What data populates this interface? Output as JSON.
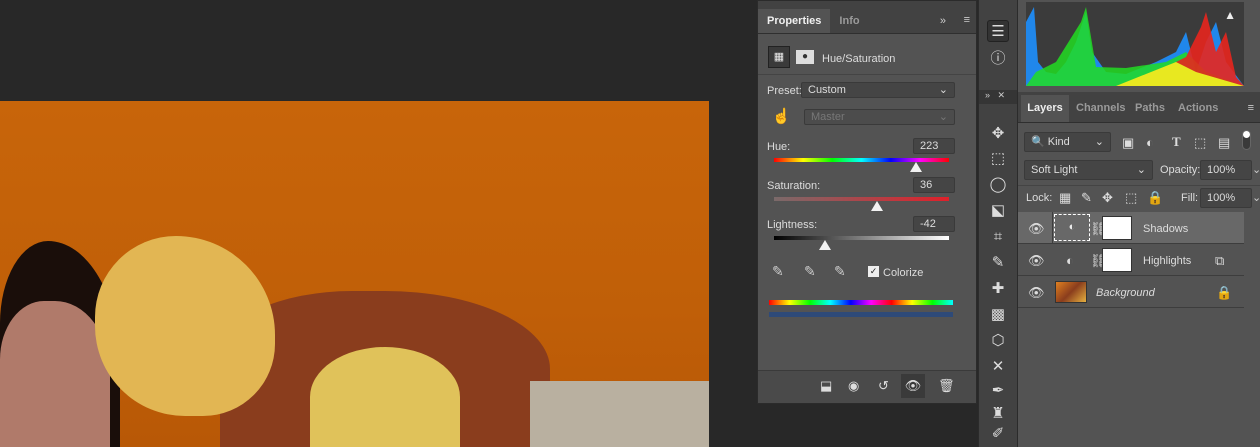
{
  "properties": {
    "tabs": [
      "Properties",
      "Info"
    ],
    "adjustment_title": "Hue/Saturation",
    "preset_label": "Preset:",
    "preset_value": "Custom",
    "channel_value": "Master",
    "hue_label": "Hue:",
    "hue_value": "223",
    "hue_fraction": 0.81,
    "saturation_label": "Saturation:",
    "saturation_value": "36",
    "saturation_fraction": 0.59,
    "lightness_label": "Lightness:",
    "lightness_value": "-42",
    "lightness_fraction": 0.29,
    "colorize_label": "Colorize",
    "colorize_checked": true
  },
  "histogram": {
    "warning_icon": "alert-icon"
  },
  "layers": {
    "tabs": [
      "Layers",
      "Channels",
      "Paths",
      "Actions"
    ],
    "filter_kind": "Kind",
    "blend_mode": "Soft Light",
    "opacity_label": "Opacity:",
    "opacity_value": "100%",
    "lock_label": "Lock:",
    "fill_label": "Fill:",
    "fill_value": "100%",
    "items": [
      {
        "name": "Shadows",
        "selected": true
      },
      {
        "name": "Highlights",
        "selected": false
      },
      {
        "name": "Background",
        "selected": false
      }
    ]
  },
  "colors": {
    "accent": "#535353",
    "canvas_orange": "#c8650a"
  }
}
